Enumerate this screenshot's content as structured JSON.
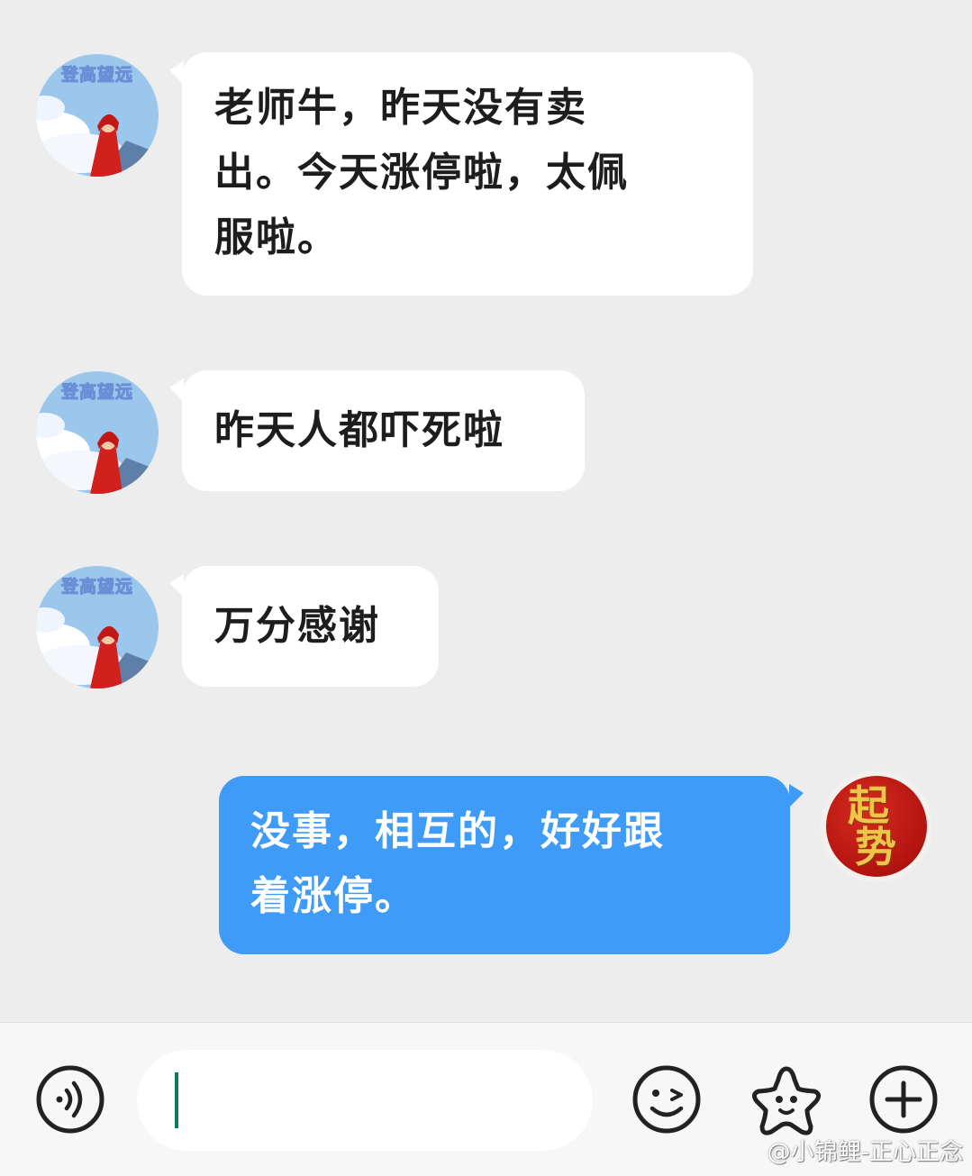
{
  "contact": {
    "avatar_caption": "登高望远",
    "avatar_icon": "girl-red-cloak-avatar-icon"
  },
  "me": {
    "avatar_line1": "起",
    "avatar_line2": "势",
    "bubble_color": "#3e9bf8"
  },
  "messages": [
    {
      "from": "contact",
      "lines": [
        "老师牛，昨天没有卖",
        "出。今天涨停啦，太佩",
        "服啦。"
      ]
    },
    {
      "from": "contact",
      "lines": [
        "昨天人都吓死啦"
      ]
    },
    {
      "from": "contact",
      "lines": [
        "万分感谢"
      ]
    },
    {
      "from": "me",
      "lines": [
        "没事，相互的，好好跟",
        "着涨停。"
      ]
    }
  ],
  "input_bar": {
    "voice_icon": "voice-icon",
    "text_value": "",
    "emoji_icon": "emoji-icon",
    "sticker_icon": "star-sticker-icon",
    "add_icon": "plus-circle-icon"
  },
  "watermark": "@小锦鲤-正心正念"
}
